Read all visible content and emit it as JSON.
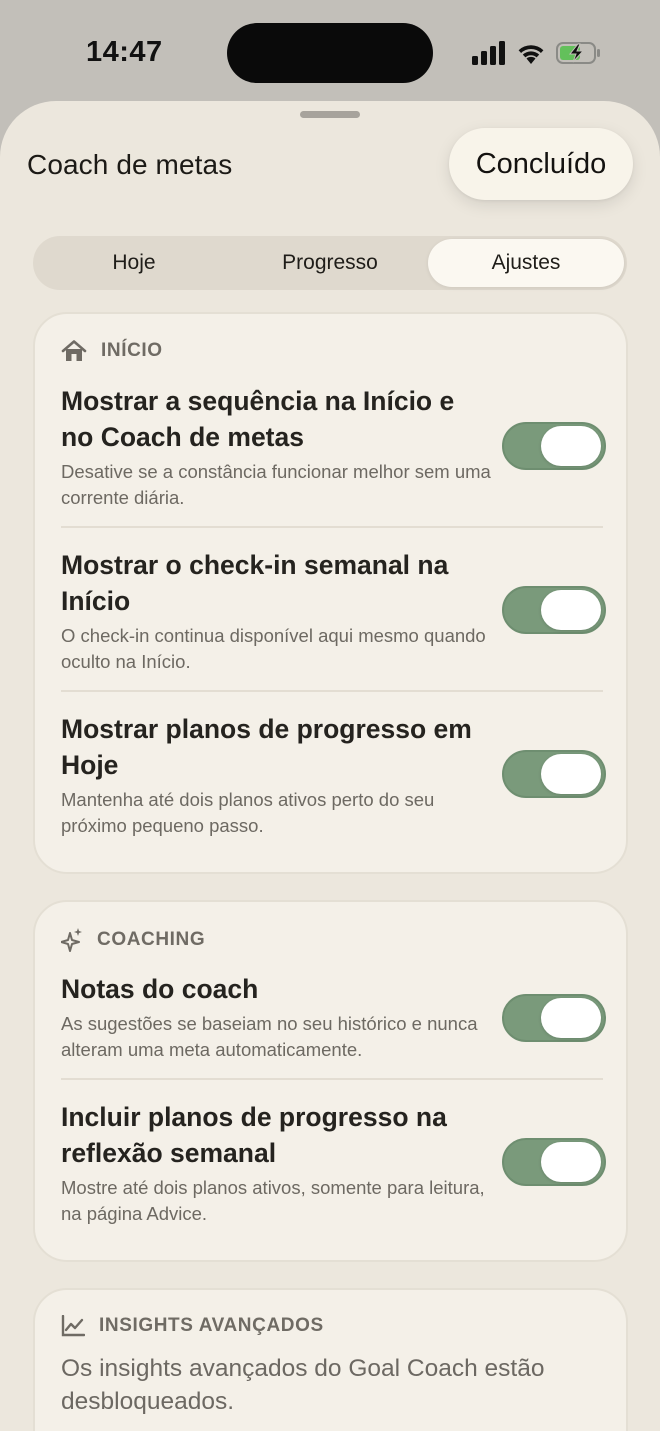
{
  "status_bar": {
    "time": "14:47",
    "icons": [
      "cellular-signal-icon",
      "wifi-icon",
      "battery-charging-icon"
    ]
  },
  "sheet": {
    "title": "Coach de metas",
    "done_label": "Concluído"
  },
  "tabs": [
    {
      "label": "Hoje",
      "selected": false
    },
    {
      "label": "Progresso",
      "selected": false
    },
    {
      "label": "Ajustes",
      "selected": true
    }
  ],
  "sections": {
    "inicio": {
      "header": "INÍCIO",
      "icon": "house-icon",
      "rows": [
        {
          "title": "Mostrar a sequência na Início e no Coach de metas",
          "description": "Desative se a constância funcionar melhor sem uma corrente diária.",
          "enabled": true
        },
        {
          "title": "Mostrar o check-in semanal na Início",
          "description": "O check-in continua disponível aqui mesmo quando oculto na Início.",
          "enabled": true
        },
        {
          "title": "Mostrar planos de progresso em Hoje",
          "description": "Mantenha até dois planos ativos perto do seu próximo pequeno passo.",
          "enabled": true
        }
      ]
    },
    "coaching": {
      "header": "COACHING",
      "icon": "sparkles-icon",
      "rows": [
        {
          "title": "Notas do coach",
          "description": "As sugestões se baseiam no seu histórico e nunca alteram uma meta automaticamente.",
          "enabled": true
        },
        {
          "title": "Incluir planos de progresso na reflexão semanal",
          "description": "Mostre até dois planos ativos, somente para leitura, na página Advice.",
          "enabled": true
        }
      ]
    },
    "insights": {
      "header": "INSIGHTS AVANÇADOS",
      "icon": "chart-line-icon",
      "text": "Os insights avançados do Goal Coach estão desbloqueados."
    }
  },
  "colors": {
    "toggle_on": "#7a9a7b",
    "sheet_background": "#ece7dd",
    "card_background": "#f4f0e8"
  }
}
